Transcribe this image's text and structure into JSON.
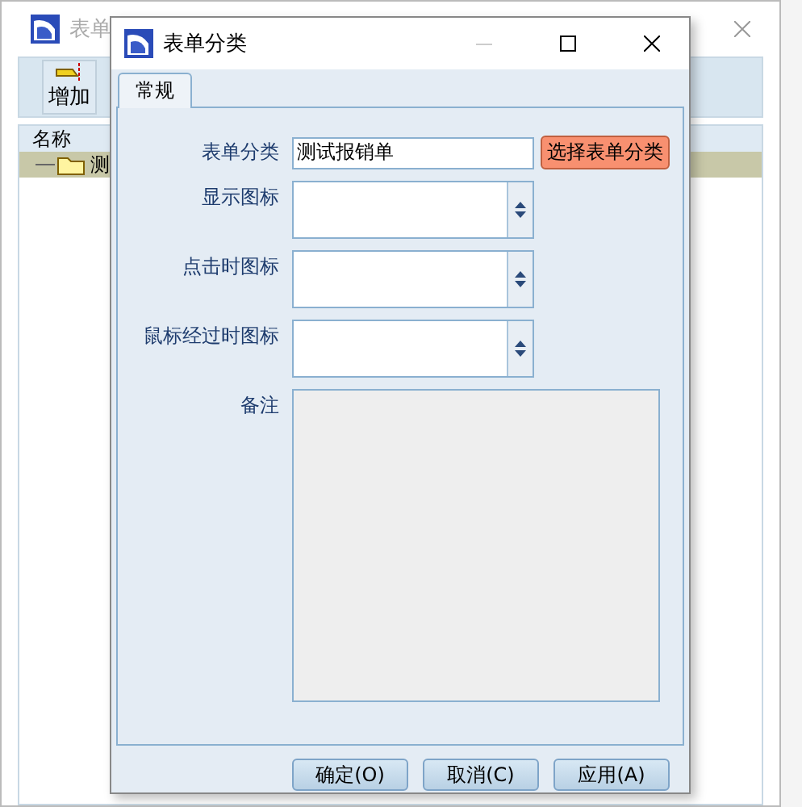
{
  "background_window": {
    "title": "表单",
    "toolbar": [
      {
        "label": "增加"
      }
    ],
    "list": {
      "columns": [
        "名称"
      ],
      "rows": [
        {
          "label": "测",
          "selected": true
        }
      ]
    }
  },
  "dialog": {
    "title": "表单分类",
    "tabs": [
      {
        "label": "常规",
        "selected": true
      }
    ],
    "fields": [
      {
        "kind": "text",
        "label": "表单分类",
        "value": "测试报销单",
        "button": "选择表单分类"
      },
      {
        "kind": "spinner",
        "label": "显示图标"
      },
      {
        "kind": "spinner",
        "label": "点击时图标"
      },
      {
        "kind": "spinner",
        "label": "鼠标经过时图标"
      },
      {
        "kind": "textarea",
        "label": "备注"
      }
    ],
    "buttons": [
      "确定(O)",
      "取消(C)",
      "应用(A)"
    ]
  }
}
